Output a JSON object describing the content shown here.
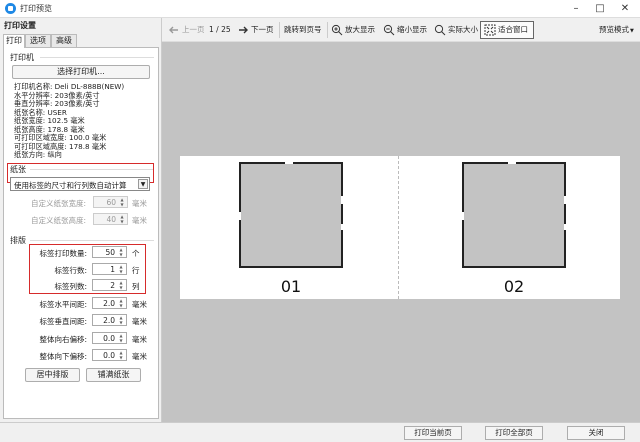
{
  "window": {
    "title": "打印预览"
  },
  "left": {
    "title": "打印设置",
    "tabs": [
      "打印",
      "选项",
      "高级"
    ],
    "printer_section": "打印机",
    "select_printer_label": "选择打印机...",
    "printer_info": [
      "打印机名称: Deli DL-888B(NEW)",
      "水平分辨率: 203像素/英寸",
      "垂直分辨率: 203像素/英寸",
      "纸张名称: USER",
      "纸张宽度: 102.5 毫米",
      "纸张高度: 178.8 毫米",
      "可打印区域宽度: 100.0 毫米",
      "可打印区域高度: 178.8 毫米",
      "纸张方向: 纵向"
    ],
    "paper_section": "纸张",
    "paper_mode": "使用标签的尺寸和行列数自动计算",
    "custom_width_label": "自定义纸张宽度:",
    "custom_width_value": "60",
    "custom_height_label": "自定义纸张高度:",
    "custom_height_value": "40",
    "layout_section": "排版",
    "fields": [
      {
        "label": "标签打印数量:",
        "value": "50",
        "unit": "个"
      },
      {
        "label": "标签行数:",
        "value": "1",
        "unit": "行"
      },
      {
        "label": "标签列数:",
        "value": "2",
        "unit": "列"
      },
      {
        "label": "标签水平间距:",
        "value": "2.0",
        "unit": "毫米"
      },
      {
        "label": "标签垂直间距:",
        "value": "2.0",
        "unit": "毫米"
      },
      {
        "label": "整体向右偏移:",
        "value": "0.0",
        "unit": "毫米"
      },
      {
        "label": "整体向下偏移:",
        "value": "0.0",
        "unit": "毫米"
      }
    ],
    "mm_unit": "毫米",
    "center_button": "居中排版",
    "fill_button": "铺满纸张"
  },
  "toolbar": {
    "prev": "上一页",
    "page_indicator": "1 / 25",
    "next": "下一页",
    "goto": "跳转到页号",
    "zoom_in": "放大显示",
    "zoom_out": "缩小显示",
    "actual": "实际大小",
    "fit": "适合窗口",
    "preview_mode": "预览模式"
  },
  "preview": {
    "labels": [
      "01",
      "02"
    ]
  },
  "bottom": {
    "print_current": "打印当前页",
    "print_all": "打印全部页",
    "close": "关闭"
  },
  "colors": {
    "highlight": "#d62b2b",
    "canvas": "#c3c3c3",
    "accent": "#1e88e5"
  }
}
